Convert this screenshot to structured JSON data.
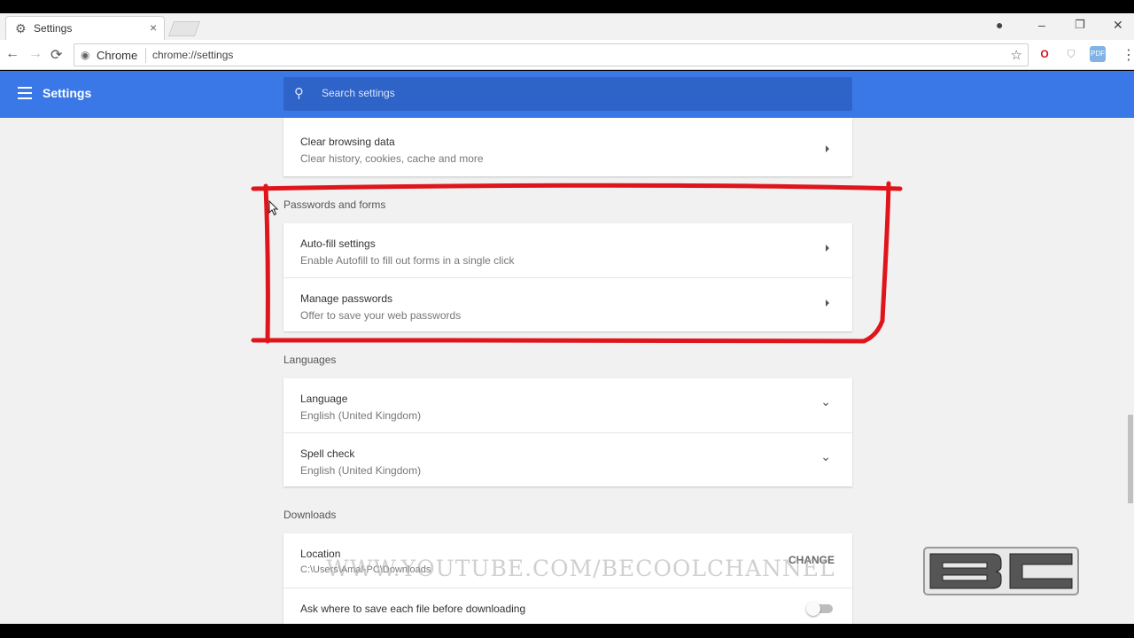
{
  "browser": {
    "tab_title": "Settings",
    "tab_close": "×",
    "site_label": "Chrome",
    "url": "chrome://settings",
    "nav": {
      "back": "←",
      "forward": "→",
      "reload": "⟳"
    },
    "window_buttons": {
      "account": "●",
      "minimize": "–",
      "restore": "❐",
      "close": "✕"
    }
  },
  "header": {
    "title": "Settings",
    "search_placeholder": "Search settings"
  },
  "sections": {
    "privacy": {
      "clear_browsing": {
        "title": "Clear browsing data",
        "subtitle": "Clear history, cookies, cache and more"
      }
    },
    "passwords": {
      "title": "Passwords and forms",
      "autofill": {
        "title": "Auto-fill settings",
        "subtitle": "Enable Autofill to fill out forms in a single click"
      },
      "manage": {
        "title": "Manage passwords",
        "subtitle": "Offer to save your web passwords"
      }
    },
    "languages": {
      "title": "Languages",
      "language": {
        "title": "Language",
        "subtitle": "English (United Kingdom)"
      },
      "spell_check": {
        "title": "Spell check",
        "subtitle": "English (United Kingdom)"
      }
    },
    "downloads": {
      "title": "Downloads",
      "location": {
        "title": "Location",
        "subtitle": "C:\\Users\\Amal-PC\\Downloads",
        "button": "CHANGE"
      },
      "ask": {
        "title": "Ask where to save each file before downloading",
        "enabled": false
      }
    }
  },
  "overlay": {
    "watermark": "WWW.YOUTUBE.COM/BECOOLCHANNEL",
    "logo_text": "BC",
    "highlight_color": "#e0141b"
  }
}
